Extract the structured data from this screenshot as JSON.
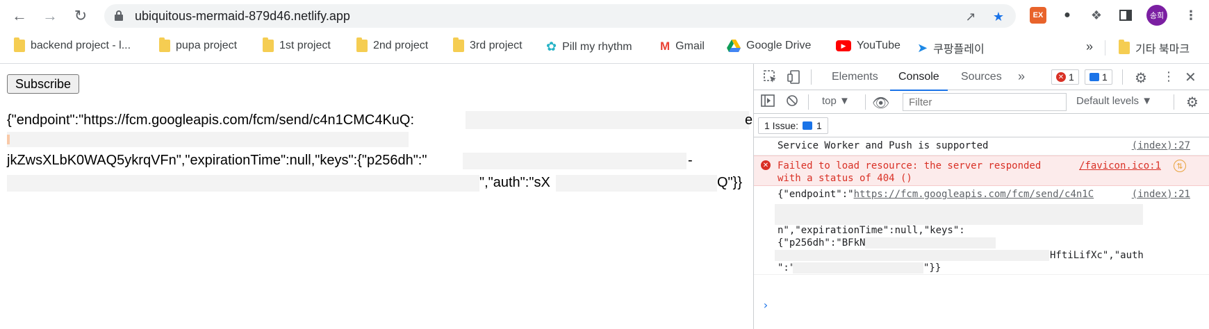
{
  "browser": {
    "url": "ubiquitous-mermaid-879d46.netlify.app",
    "profile_initials": "송희",
    "extension_ex_label": "EX"
  },
  "bookmarks": {
    "items": [
      {
        "label": "backend project - l...",
        "icon": "folder-icon"
      },
      {
        "label": "pupa project",
        "icon": "folder-icon"
      },
      {
        "label": "1st project",
        "icon": "folder-icon"
      },
      {
        "label": "2nd project",
        "icon": "folder-icon"
      },
      {
        "label": "3rd project",
        "icon": "folder-icon"
      },
      {
        "label": "Pill my rhythm",
        "icon": "pill-icon"
      },
      {
        "label": "Gmail",
        "icon": "gmail-icon"
      },
      {
        "label": "Google Drive",
        "icon": "drive-icon"
      },
      {
        "label": "YouTube",
        "icon": "youtube-icon"
      },
      {
        "label": "쿠팡플레이",
        "icon": "coupang-icon"
      }
    ],
    "overflow_label": "»",
    "other_bookmarks_label": "기타 북마크"
  },
  "page": {
    "subscribe_label": "Subscribe",
    "json_line1": "{\"endpoint\":\"https://fcm.googleapis.com/fcm/send/c4n1CMC4KuQ:",
    "json_line1_end": "e",
    "json_line3": "jkZwsXLbK0WAQ5ykrqVFn\",\"expirationTime\":null,\"keys\":{\"p256dh\":\"",
    "json_line3_end": "-",
    "json_line4_auth": "\",\"auth\":\"sX",
    "json_line4_end": "Q\"}}"
  },
  "devtools": {
    "tabs": [
      "Elements",
      "Console",
      "Sources"
    ],
    "active_tab": "Console",
    "error_count": "1",
    "message_count": "1",
    "context": "top",
    "filter_placeholder": "Filter",
    "levels_label": "Default levels",
    "issues_label": "1 Issue:",
    "issues_count": "1",
    "messages": [
      {
        "text": "Service Worker and Push is supported",
        "source": "(index):27"
      },
      {
        "text1": "Failed to load resource: the server responded",
        "text2": "with a status of 404 ()",
        "source": "/favicon.ico:1"
      },
      {
        "line1": "{\"endpoint\":\"",
        "link": "https://fcm.googleapis.com/fcm/send/c4n1C",
        "source": "(index):21",
        "line3": "n\",\"expirationTime\":null,\"keys\":",
        "line4": "{\"p256dh\":\"BFkNyl",
        "line5": "HftiLifXc\",\"auth",
        "line6a": "\":\"",
        "line6b": "\"}}"
      }
    ],
    "prompt": "›"
  }
}
